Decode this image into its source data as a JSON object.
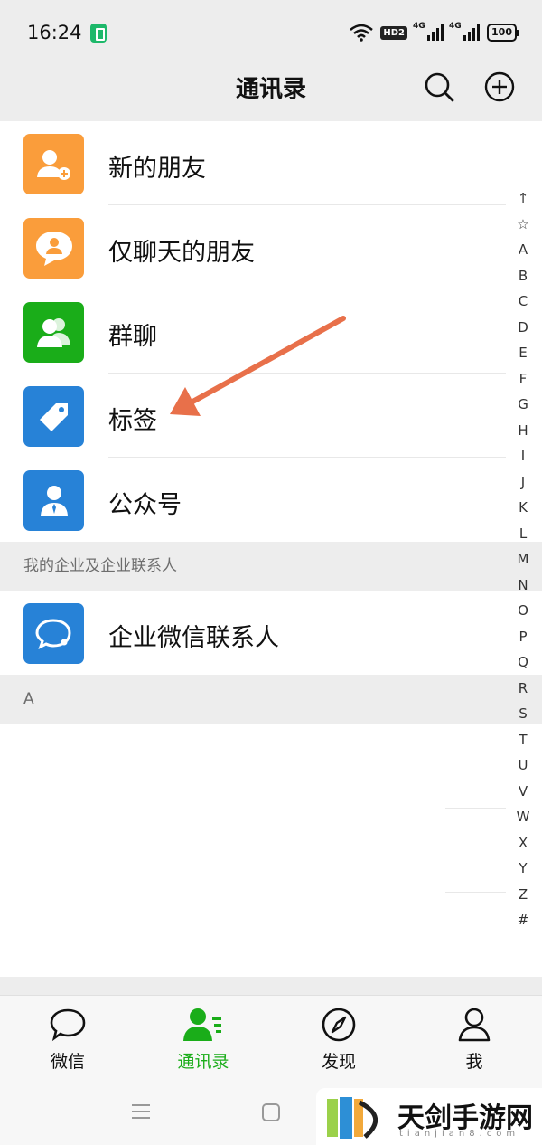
{
  "status": {
    "time": "16:24",
    "hd": "HD2",
    "net1": "4G",
    "net2": "4G",
    "battery": "100"
  },
  "header": {
    "title": "通讯录"
  },
  "entries": [
    {
      "label": "新的朋友",
      "icon": "add-friend-icon",
      "color": "#fa9d3b"
    },
    {
      "label": "仅聊天的朋友",
      "icon": "chat-only-icon",
      "color": "#fa9d3b"
    },
    {
      "label": "群聊",
      "icon": "group-chat-icon",
      "color": "#1aad19"
    },
    {
      "label": "标签",
      "icon": "tag-icon",
      "color": "#2782d7"
    },
    {
      "label": "公众号",
      "icon": "official-account-icon",
      "color": "#2782d7"
    }
  ],
  "enterprise": {
    "section_title": "我的企业及企业联系人",
    "contact_label": "企业微信联系人",
    "color": "#2782d7"
  },
  "section_a": "A",
  "index": [
    "↑",
    "☆",
    "A",
    "B",
    "C",
    "D",
    "E",
    "F",
    "G",
    "H",
    "I",
    "J",
    "K",
    "L",
    "M",
    "N",
    "O",
    "P",
    "Q",
    "R",
    "S",
    "T",
    "U",
    "V",
    "W",
    "X",
    "Y",
    "Z",
    "#"
  ],
  "tabs": [
    {
      "label": "微信",
      "icon": "chat-bubble-icon"
    },
    {
      "label": "通讯录",
      "icon": "contacts-icon",
      "active": true
    },
    {
      "label": "发现",
      "icon": "compass-icon"
    },
    {
      "label": "我",
      "icon": "person-icon"
    }
  ],
  "watermark": {
    "text": "天剑手游网",
    "sub": "tianjian8.com"
  },
  "colors": {
    "accent": "#1aad19",
    "annotation_arrow": "#e8704a"
  }
}
